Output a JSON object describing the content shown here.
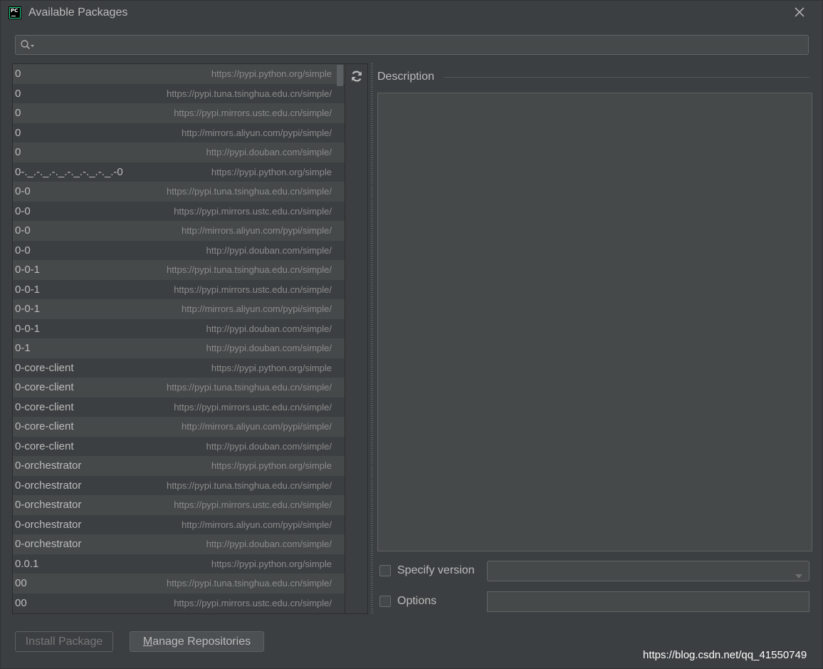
{
  "window": {
    "title": "Available Packages",
    "app_icon_text": "PC"
  },
  "search": {
    "placeholder": "",
    "value": ""
  },
  "packages": [
    {
      "name": "0",
      "repo": "https://pypi.python.org/simple"
    },
    {
      "name": "0",
      "repo": "https://pypi.tuna.tsinghua.edu.cn/simple/"
    },
    {
      "name": "0",
      "repo": "https://pypi.mirrors.ustc.edu.cn/simple/"
    },
    {
      "name": "0",
      "repo": "http://mirrors.aliyun.com/pypi/simple/"
    },
    {
      "name": "0",
      "repo": "http://pypi.douban.com/simple/"
    },
    {
      "name": "0-._.-._.-._.-._.-._.-._.-0",
      "repo": "https://pypi.python.org/simple"
    },
    {
      "name": "0-0",
      "repo": "https://pypi.tuna.tsinghua.edu.cn/simple/"
    },
    {
      "name": "0-0",
      "repo": "https://pypi.mirrors.ustc.edu.cn/simple/"
    },
    {
      "name": "0-0",
      "repo": "http://mirrors.aliyun.com/pypi/simple/"
    },
    {
      "name": "0-0",
      "repo": "http://pypi.douban.com/simple/"
    },
    {
      "name": "0-0-1",
      "repo": "https://pypi.tuna.tsinghua.edu.cn/simple/"
    },
    {
      "name": "0-0-1",
      "repo": "https://pypi.mirrors.ustc.edu.cn/simple/"
    },
    {
      "name": "0-0-1",
      "repo": "http://mirrors.aliyun.com/pypi/simple/"
    },
    {
      "name": "0-0-1",
      "repo": "http://pypi.douban.com/simple/"
    },
    {
      "name": "0-1",
      "repo": "http://pypi.douban.com/simple/"
    },
    {
      "name": "0-core-client",
      "repo": "https://pypi.python.org/simple"
    },
    {
      "name": "0-core-client",
      "repo": "https://pypi.tuna.tsinghua.edu.cn/simple/"
    },
    {
      "name": "0-core-client",
      "repo": "https://pypi.mirrors.ustc.edu.cn/simple/"
    },
    {
      "name": "0-core-client",
      "repo": "http://mirrors.aliyun.com/pypi/simple/"
    },
    {
      "name": "0-core-client",
      "repo": "http://pypi.douban.com/simple/"
    },
    {
      "name": "0-orchestrator",
      "repo": "https://pypi.python.org/simple"
    },
    {
      "name": "0-orchestrator",
      "repo": "https://pypi.tuna.tsinghua.edu.cn/simple/"
    },
    {
      "name": "0-orchestrator",
      "repo": "https://pypi.mirrors.ustc.edu.cn/simple/"
    },
    {
      "name": "0-orchestrator",
      "repo": "http://mirrors.aliyun.com/pypi/simple/"
    },
    {
      "name": "0-orchestrator",
      "repo": "http://pypi.douban.com/simple/"
    },
    {
      "name": "0.0.1",
      "repo": "https://pypi.python.org/simple"
    },
    {
      "name": "00",
      "repo": "https://pypi.tuna.tsinghua.edu.cn/simple/"
    },
    {
      "name": "00",
      "repo": "https://pypi.mirrors.ustc.edu.cn/simple/"
    }
  ],
  "description": {
    "label": "Description",
    "text": ""
  },
  "specify_version": {
    "label": "Specify version",
    "checked": false,
    "value": ""
  },
  "options": {
    "label": "Options",
    "checked": false,
    "value": ""
  },
  "buttons": {
    "install_label": "Install Package",
    "manage_mnemonic": "M",
    "manage_rest": "anage Repositories"
  },
  "watermark": "https://blog.csdn.net/qq_41550749",
  "colors": {
    "background": "#3c3f41",
    "row_alt": "#45494a",
    "text": "#bbbbbb",
    "repo_text": "#8c8c8c",
    "disabled_text": "#777777"
  }
}
